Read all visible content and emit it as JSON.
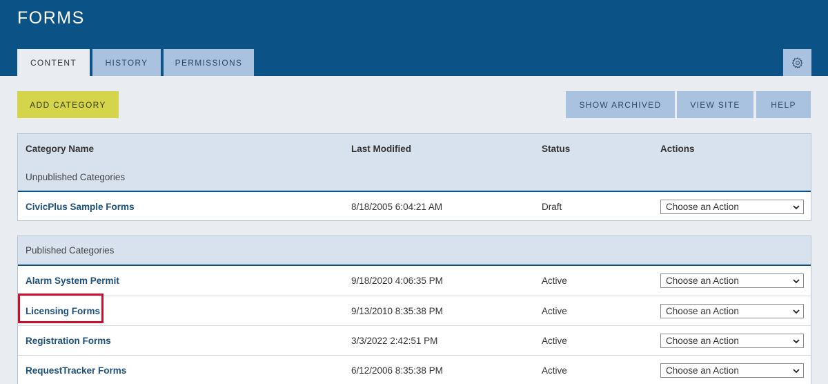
{
  "header": {
    "title": "FORMS",
    "tabs": [
      {
        "label": "CONTENT",
        "active": true
      },
      {
        "label": "HISTORY",
        "active": false
      },
      {
        "label": "PERMISSIONS",
        "active": false
      }
    ],
    "settings_icon": "gear-icon"
  },
  "toolbar": {
    "add_category": "ADD CATEGORY",
    "show_archived": "SHOW ARCHIVED",
    "view_site": "VIEW SITE",
    "help": "HELP"
  },
  "table": {
    "columns": {
      "name": "Category Name",
      "modified": "Last Modified",
      "status": "Status",
      "actions": "Actions"
    },
    "unpublished": {
      "label": "Unpublished Categories",
      "rows": [
        {
          "name": "CivicPlus Sample Forms",
          "modified": "8/18/2005 6:04:21 AM",
          "status": "Draft",
          "action": "Choose an Action"
        }
      ]
    },
    "published": {
      "label": "Published Categories",
      "rows": [
        {
          "name": "Alarm System Permit",
          "modified": "9/18/2020 4:06:35 PM",
          "status": "Active",
          "action": "Choose an Action"
        },
        {
          "name": "Licensing Forms",
          "modified": "9/13/2010 8:35:38 PM",
          "status": "Active",
          "action": "Choose an Action"
        },
        {
          "name": "Registration Forms",
          "modified": "3/3/2022 2:42:51 PM",
          "status": "Active",
          "action": "Choose an Action"
        },
        {
          "name": "RequestTracker Forms",
          "modified": "6/12/2006 8:35:38 PM",
          "status": "Active",
          "action": "Choose an Action"
        }
      ]
    }
  },
  "colors": {
    "header_bg": "#0b5387",
    "tab_bg": "#a9c2df",
    "add_button": "#d4d54a",
    "link": "#1b4f7d",
    "highlight": "#c8102e"
  }
}
